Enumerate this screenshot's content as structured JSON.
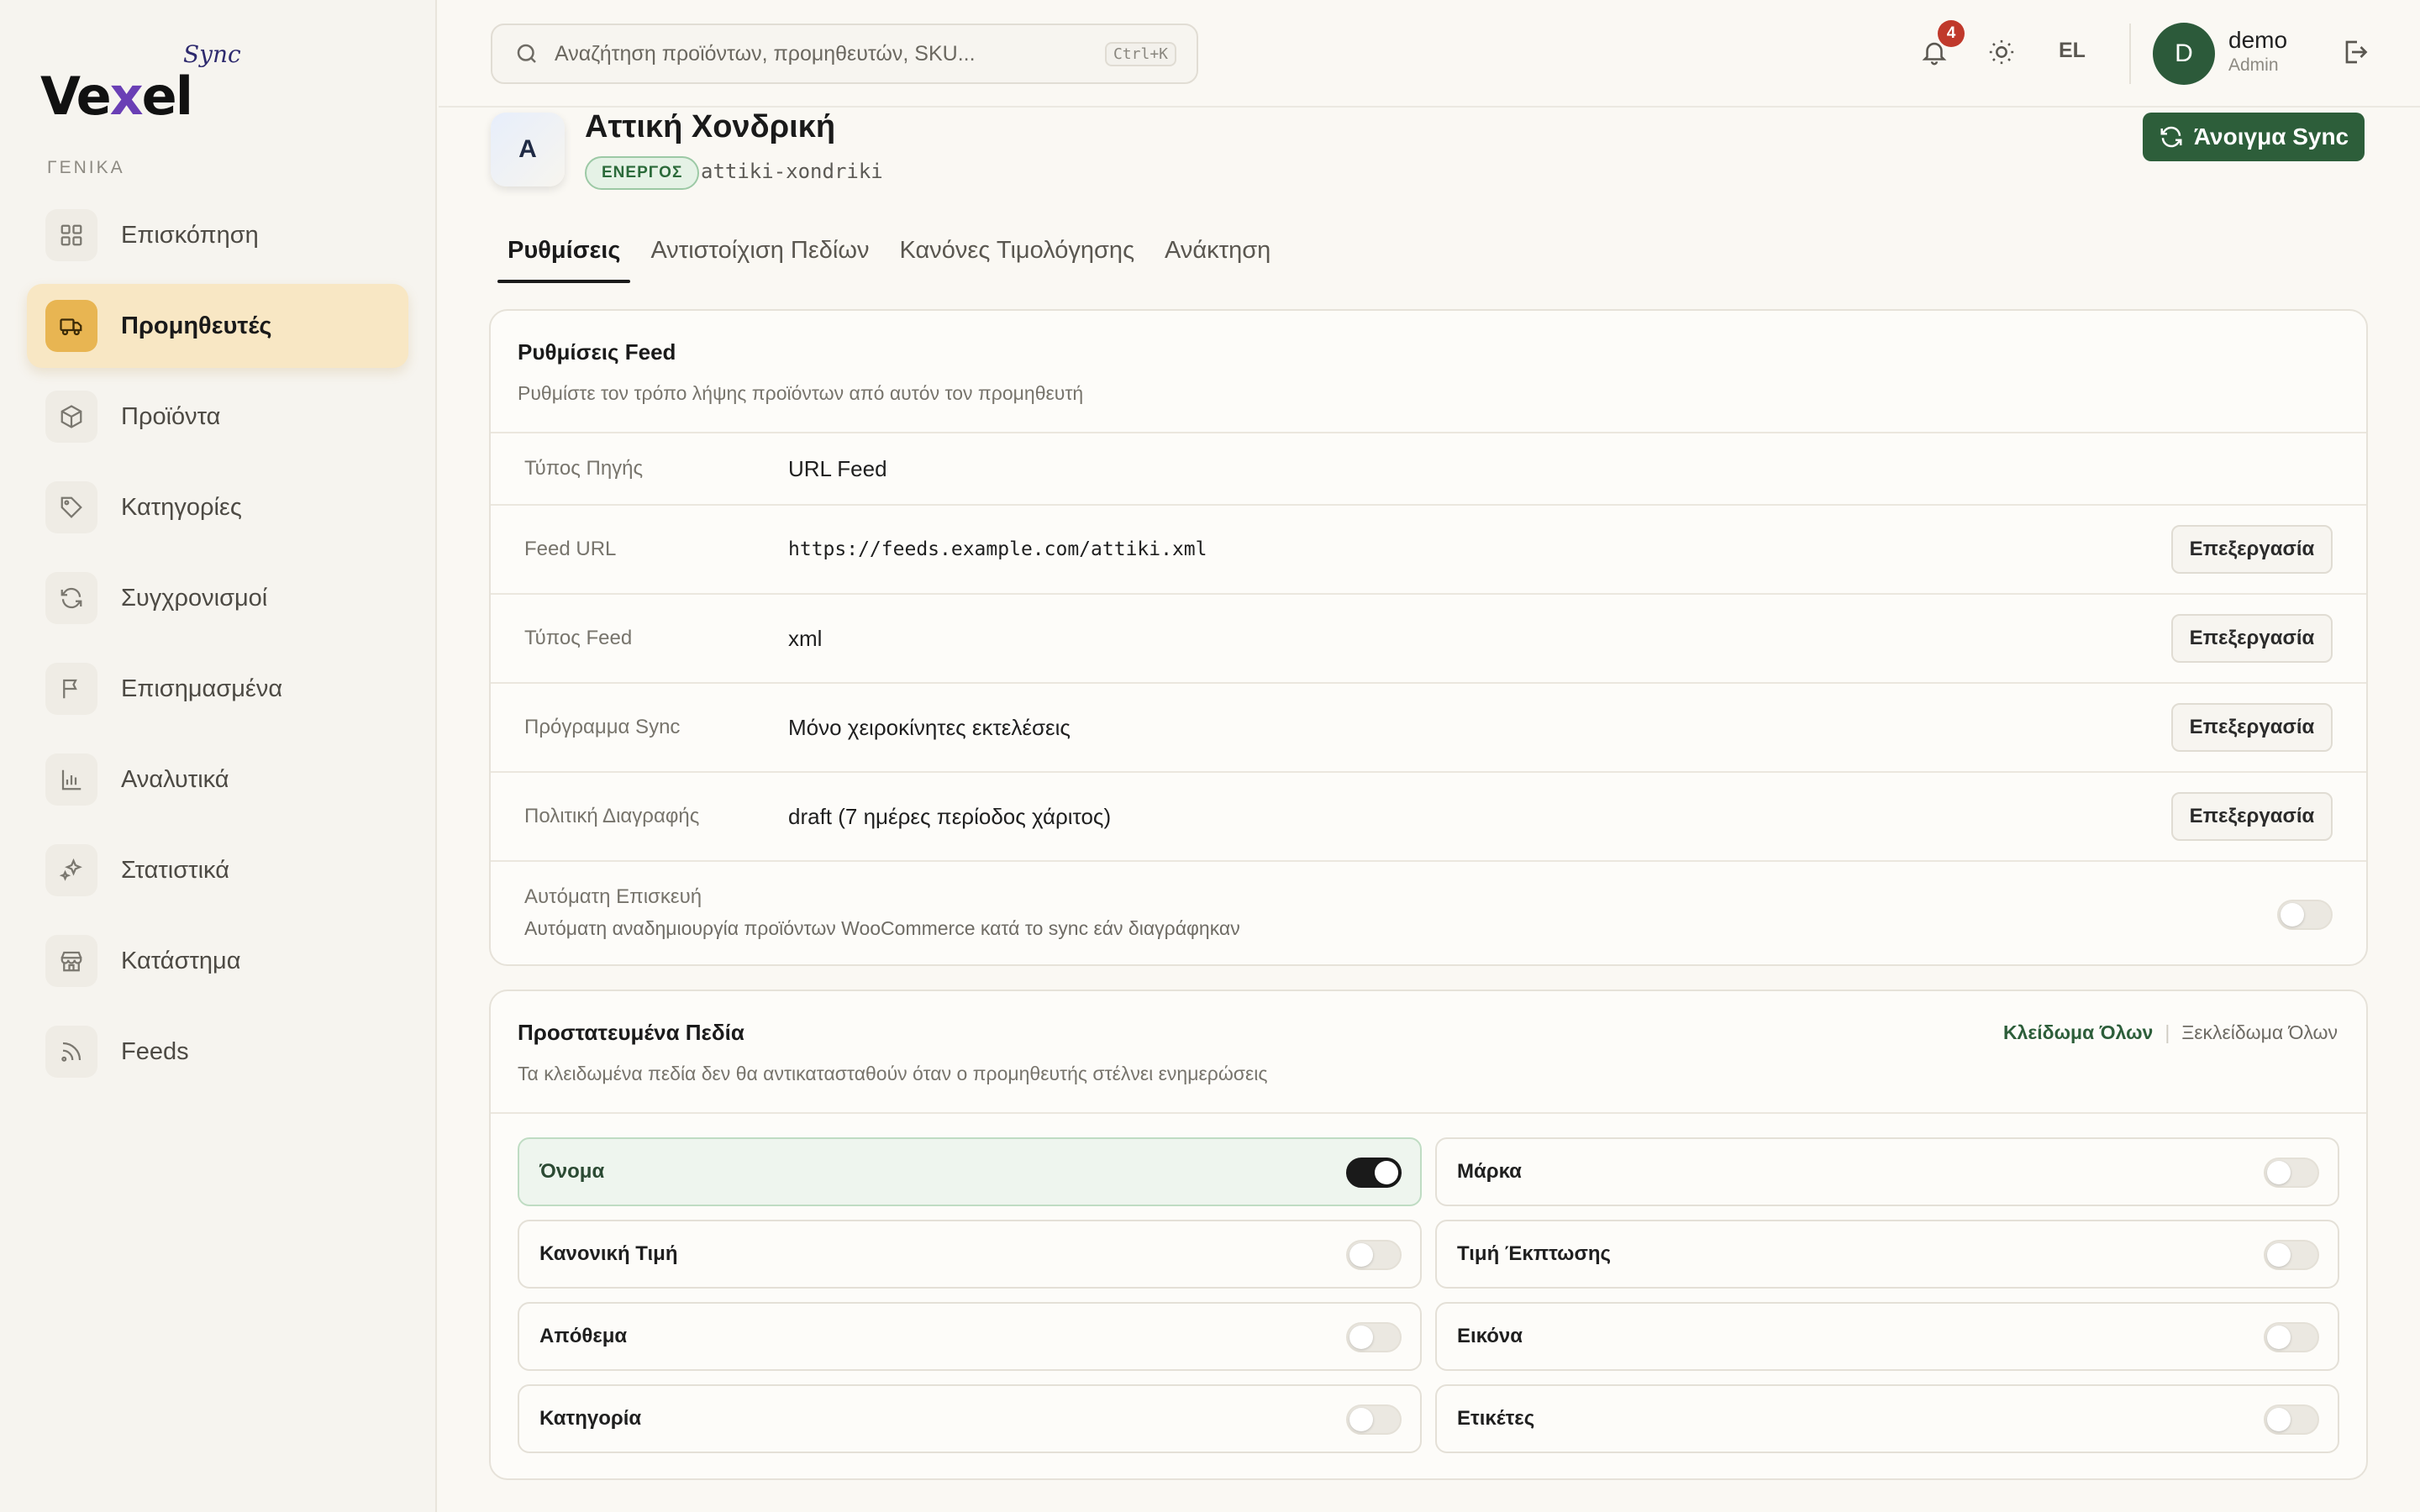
{
  "brand": {
    "name_prefix": "Ve",
    "name_x": "x",
    "name_suffix": "el",
    "sub": "Sync"
  },
  "sidebar": {
    "section_label": "ΓΕΝΙΚΑ",
    "items": [
      {
        "label": "Επισκόπηση",
        "icon": "grid-icon",
        "active": false
      },
      {
        "label": "Προμηθευτές",
        "icon": "truck-icon",
        "active": true
      },
      {
        "label": "Προϊόντα",
        "icon": "box-icon",
        "active": false
      },
      {
        "label": "Κατηγορίες",
        "icon": "tag-icon",
        "active": false
      },
      {
        "label": "Συγχρονισμοί",
        "icon": "refresh-icon",
        "active": false
      },
      {
        "label": "Επισημασμένα",
        "icon": "flag-icon",
        "active": false
      },
      {
        "label": "Αναλυτικά",
        "icon": "bar-chart-icon",
        "active": false
      },
      {
        "label": "Στατιστικά",
        "icon": "sparkles-icon",
        "active": false
      },
      {
        "label": "Κατάστημα",
        "icon": "store-icon",
        "active": false
      },
      {
        "label": "Feeds",
        "icon": "rss-icon",
        "active": false
      }
    ]
  },
  "topbar": {
    "search_placeholder": "Αναζήτηση προϊόντων, προμηθευτών, SKU...",
    "shortcut": "Ctrl+K",
    "notifications_count": "4",
    "language": "EL",
    "user": {
      "initial": "D",
      "name": "demo",
      "role": "Admin"
    }
  },
  "supplier": {
    "initial": "A",
    "name": "Αττική Χονδρική",
    "status": "ΕΝΕΡΓΟΣ",
    "slug": "attiki-xondriki",
    "open_sync_label": "Άνοιγμα Sync"
  },
  "tabs": [
    {
      "label": "Ρυθμίσεις",
      "active": true
    },
    {
      "label": "Αντιστοίχιση Πεδίων",
      "active": false
    },
    {
      "label": "Κανόνες Τιμολόγησης",
      "active": false
    },
    {
      "label": "Ανάκτηση",
      "active": false
    }
  ],
  "feed_settings": {
    "title": "Ρυθμίσεις Feed",
    "description": "Ρυθμίστε τον τρόπο λήψης προϊόντων από αυτόν τον προμηθευτή",
    "edit_label": "Επεξεργασία",
    "rows": [
      {
        "label": "Τύπος Πηγής",
        "value": "URL Feed"
      },
      {
        "label": "Feed URL",
        "value": "https://feeds.example.com/attiki.xml"
      },
      {
        "label": "Τύπος Feed",
        "value": "xml"
      },
      {
        "label": "Πρόγραμμα Sync",
        "value": "Μόνο χειροκίνητες εκτελέσεις"
      },
      {
        "label": "Πολιτική Διαγραφής",
        "value": "draft (7 ημέρες περίοδος χάριτος)"
      }
    ],
    "auto_repair": {
      "title": "Αυτόματη Επισκευή",
      "description": "Αυτόματη αναδημιουργία προϊόντων WooCommerce κατά το sync εάν διαγράφηκαν",
      "enabled": false
    }
  },
  "protected_fields": {
    "title": "Προστατευμένα Πεδία",
    "description": "Τα κλειδωμένα πεδία δεν θα αντικατασταθούν όταν ο προμηθευτής στέλνει ενημερώσεις",
    "lock_all": "Κλείδωμα Όλων",
    "separator": "|",
    "unlock_all": "Ξεκλείδωμα Όλων",
    "fields": [
      {
        "label": "Όνομα",
        "locked": true
      },
      {
        "label": "Μάρκα",
        "locked": false
      },
      {
        "label": "Κανονική Τιμή",
        "locked": false
      },
      {
        "label": "Τιμή Έκπτωσης",
        "locked": false
      },
      {
        "label": "Απόθεμα",
        "locked": false
      },
      {
        "label": "Εικόνα",
        "locked": false
      },
      {
        "label": "Κατηγορία",
        "locked": false
      },
      {
        "label": "Ετικέτες",
        "locked": false
      }
    ]
  },
  "colors": {
    "accent": "#2d5e3a",
    "active_nav": "#f8e7c4",
    "active_nav_icon": "#e8b552",
    "badge": "#c0392b"
  }
}
